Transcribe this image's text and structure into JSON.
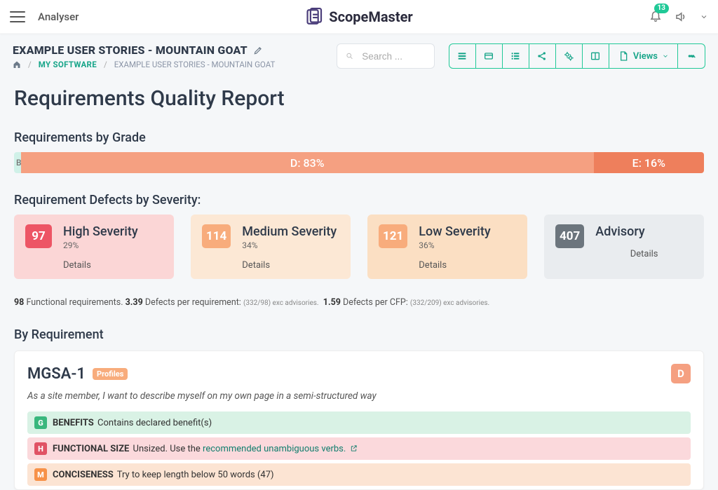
{
  "topbar": {
    "analyser": "Analyser",
    "brand": "ScopeMaster",
    "notif_count": "13"
  },
  "header": {
    "project_title": "EXAMPLE USER STORIES - MOUNTAIN GOAT",
    "crumb_my_software": "MY SOFTWARE",
    "crumb_current": "EXAMPLE USER STORIES - MOUNTAIN GOAT",
    "search_placeholder": "Search ...",
    "views_label": "Views"
  },
  "report": {
    "title": "Requirements Quality Report",
    "grades_heading": "Requirements by Grade",
    "grades": {
      "b_label": "B",
      "d_label": "D: 83%",
      "e_label": "E: 16%"
    },
    "defects_heading": "Requirement Defects by Severity:",
    "cards": {
      "high": {
        "count": "97",
        "name": "High Severity",
        "pct": "29%",
        "details": "Details"
      },
      "med": {
        "count": "114",
        "name": "Medium Severity",
        "pct": "34%",
        "details": "Details"
      },
      "low": {
        "count": "121",
        "name": "Low Severity",
        "pct": "36%",
        "details": "Details"
      },
      "adv": {
        "count": "407",
        "name": "Advisory",
        "details": "Details"
      }
    },
    "stats": {
      "fr_count": "98",
      "fr_label": " Functional requirements. ",
      "dpr": "3.39",
      "dpr_label": " Defects per requirement: ",
      "dpr_note": "(332/98) exc advisories.",
      "dpc": "1.59",
      "dpc_label": " Defects per CFP: ",
      "dpc_note": "(332/209) exc advisories."
    },
    "byreq_heading": "By Requirement"
  },
  "req": {
    "id": "MGSA-1",
    "profiles": "Profiles",
    "grade": "D",
    "story": "As a site member, I want to describe myself on my own page in a semi-structured way",
    "issues": {
      "benefits": {
        "tag": "G",
        "label": "BENEFITS",
        "text": " Contains declared benefit(s)"
      },
      "size": {
        "tag": "H",
        "label": "FUNCTIONAL SIZE",
        "pre": " Unsized. Use the ",
        "link": "recommended unambiguous verbs."
      },
      "concise": {
        "tag": "M",
        "label": "CONCISENESS",
        "text": " Try to keep length below 50 words (47)"
      }
    }
  }
}
